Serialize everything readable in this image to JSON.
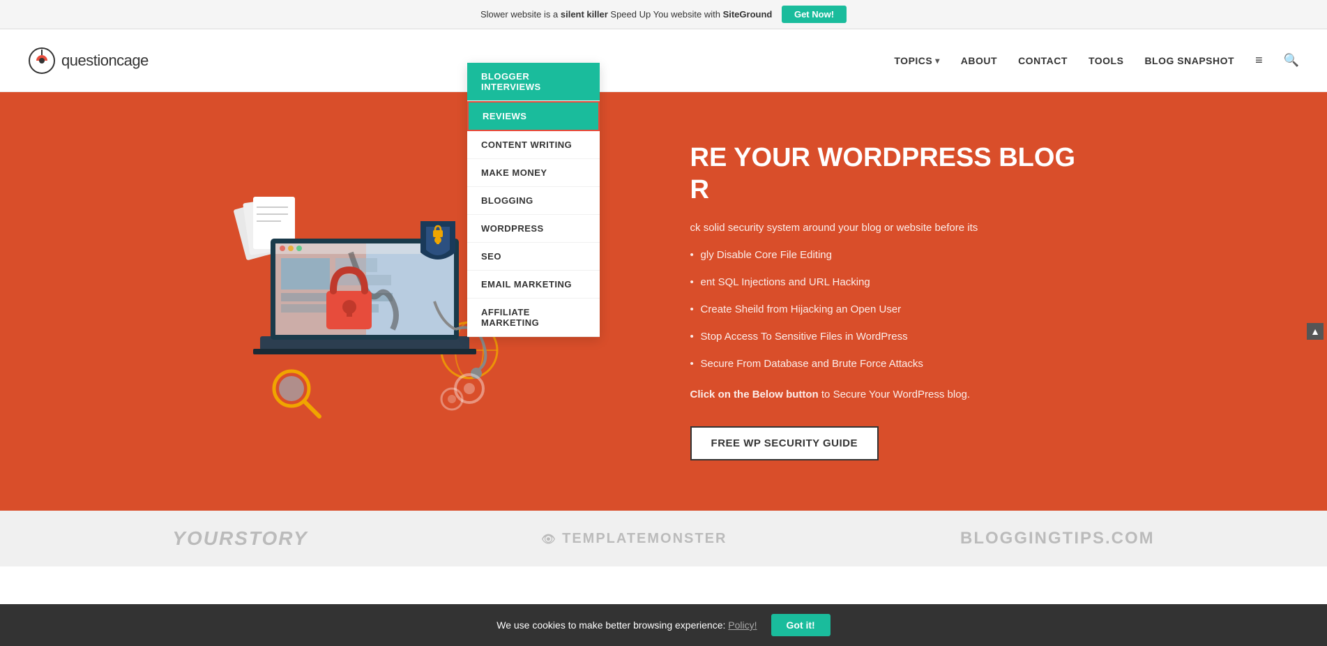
{
  "banner": {
    "text_before": "Slower website is a ",
    "bold1": "silent killer",
    "text_after": " Speed Up You website with ",
    "brand": "SiteGround",
    "btn_label": "Get Now!"
  },
  "header": {
    "logo_text": "questioncage",
    "nav": [
      {
        "label": "TOPICS",
        "has_arrow": true
      },
      {
        "label": "ABOUT",
        "has_arrow": false
      },
      {
        "label": "CONTACT",
        "has_arrow": false
      },
      {
        "label": "TOOLS",
        "has_arrow": false
      },
      {
        "label": "BLOG SNAPSHOT",
        "has_arrow": false
      }
    ]
  },
  "dropdown": {
    "items": [
      {
        "label": "BLOGGER INTERVIEWS",
        "state": "active"
      },
      {
        "label": "REVIEWS",
        "state": "highlighted"
      },
      {
        "label": "CONTENT WRITING",
        "state": "normal"
      },
      {
        "label": "MAKE MONEY",
        "state": "normal"
      },
      {
        "label": "BLOGGING",
        "state": "normal"
      },
      {
        "label": "WORDPRESS",
        "state": "normal"
      },
      {
        "label": "SEO",
        "state": "normal"
      },
      {
        "label": "EMAIL MARKETING",
        "state": "normal"
      },
      {
        "label": "AFFILIATE MARKETING",
        "state": "normal"
      }
    ]
  },
  "hero": {
    "title_line1": "RE YOUR WORDPRESS BLOG",
    "title_line2": "R",
    "description": "ck solid security system around your blog or website before its",
    "bullets": [
      "gly Disable Core File Editing",
      "ent SQL Injections and URL Hacking",
      "Create Sheild from Hijacking an Open User",
      "Stop Access To Sensitive Files in WordPress",
      "Secure From Database and Brute Force Attacks"
    ],
    "cta_prefix": "Click on the Below button",
    "cta_suffix": " to Secure Your WordPress blog.",
    "btn_label": "FREE WP Security Guide"
  },
  "logos_bar": {
    "brands": [
      {
        "name": "YOURSTORY",
        "style": "yourstory"
      },
      {
        "name": "TemplateMonster",
        "style": "templatemonster"
      },
      {
        "name": "BLOGGINGTIPS.COM",
        "style": "bloggingtips"
      }
    ]
  },
  "cookie": {
    "text": "We use cookies to make better browsing experience: ",
    "policy_label": "Policy!",
    "btn_label": "Got it!"
  }
}
